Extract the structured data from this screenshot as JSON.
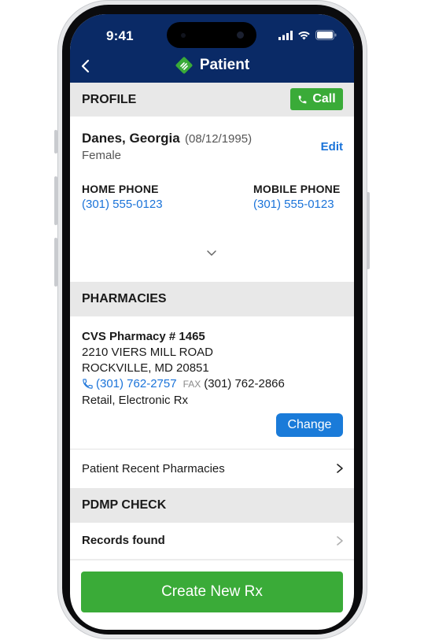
{
  "status_bar": {
    "time": "9:41"
  },
  "header": {
    "title": "Patient",
    "back_icon": "chevron-left-icon",
    "logo_icon": "app-logo-icon"
  },
  "profile": {
    "section_title": "PROFILE",
    "call_label": "Call",
    "name": "Danes, Georgia",
    "dob": "(08/12/1995)",
    "gender": "Female",
    "edit_label": "Edit",
    "home_phone_label": "HOME PHONE",
    "home_phone": "(301) 555-0123",
    "mobile_phone_label": "MOBILE PHONE",
    "mobile_phone": "(301) 555-0123"
  },
  "pharmacies": {
    "section_title": "PHARMACIES",
    "name": "CVS Pharmacy # 1465",
    "address_line1": "2210 VIERS MILL ROAD",
    "address_line2": "ROCKVILLE, MD 20851",
    "phone": "(301) 762-2757",
    "fax_label": "FAX",
    "fax": "(301) 762-2866",
    "type": "Retail, Electronic Rx",
    "change_label": "Change",
    "recent_label": "Patient Recent Pharmacies"
  },
  "pdmp": {
    "section_title": "PDMP CHECK",
    "records_label": "Records found"
  },
  "cta": {
    "label": "Create New Rx"
  },
  "colors": {
    "header": "#0a2a66",
    "green": "#3aab38",
    "blue": "#1a7bd9",
    "link": "#1a73d9"
  }
}
